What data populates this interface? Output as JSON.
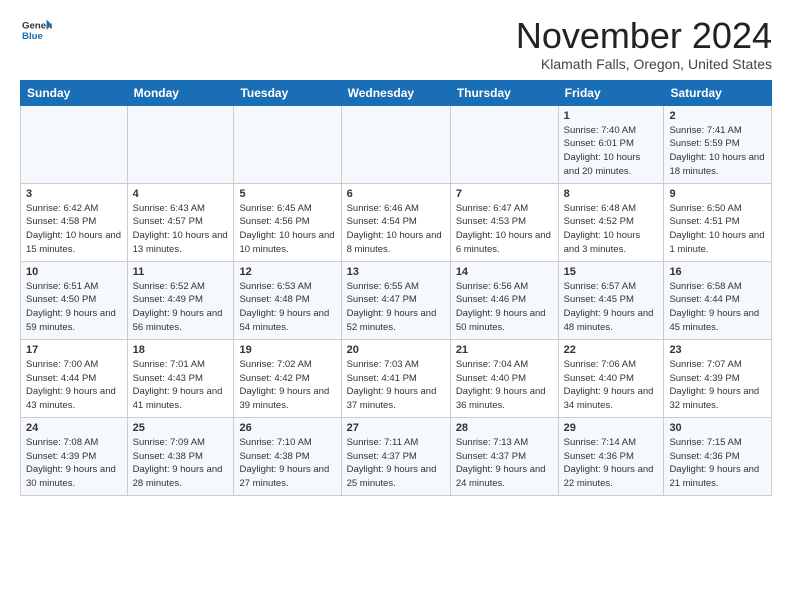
{
  "logo": {
    "line1": "General",
    "line2": "Blue"
  },
  "title": "November 2024",
  "location": "Klamath Falls, Oregon, United States",
  "weekdays": [
    "Sunday",
    "Monday",
    "Tuesday",
    "Wednesday",
    "Thursday",
    "Friday",
    "Saturday"
  ],
  "weeks": [
    [
      {
        "day": "",
        "info": ""
      },
      {
        "day": "",
        "info": ""
      },
      {
        "day": "",
        "info": ""
      },
      {
        "day": "",
        "info": ""
      },
      {
        "day": "",
        "info": ""
      },
      {
        "day": "1",
        "info": "Sunrise: 7:40 AM\nSunset: 6:01 PM\nDaylight: 10 hours and 20 minutes."
      },
      {
        "day": "2",
        "info": "Sunrise: 7:41 AM\nSunset: 5:59 PM\nDaylight: 10 hours and 18 minutes."
      }
    ],
    [
      {
        "day": "3",
        "info": "Sunrise: 6:42 AM\nSunset: 4:58 PM\nDaylight: 10 hours and 15 minutes."
      },
      {
        "day": "4",
        "info": "Sunrise: 6:43 AM\nSunset: 4:57 PM\nDaylight: 10 hours and 13 minutes."
      },
      {
        "day": "5",
        "info": "Sunrise: 6:45 AM\nSunset: 4:56 PM\nDaylight: 10 hours and 10 minutes."
      },
      {
        "day": "6",
        "info": "Sunrise: 6:46 AM\nSunset: 4:54 PM\nDaylight: 10 hours and 8 minutes."
      },
      {
        "day": "7",
        "info": "Sunrise: 6:47 AM\nSunset: 4:53 PM\nDaylight: 10 hours and 6 minutes."
      },
      {
        "day": "8",
        "info": "Sunrise: 6:48 AM\nSunset: 4:52 PM\nDaylight: 10 hours and 3 minutes."
      },
      {
        "day": "9",
        "info": "Sunrise: 6:50 AM\nSunset: 4:51 PM\nDaylight: 10 hours and 1 minute."
      }
    ],
    [
      {
        "day": "10",
        "info": "Sunrise: 6:51 AM\nSunset: 4:50 PM\nDaylight: 9 hours and 59 minutes."
      },
      {
        "day": "11",
        "info": "Sunrise: 6:52 AM\nSunset: 4:49 PM\nDaylight: 9 hours and 56 minutes."
      },
      {
        "day": "12",
        "info": "Sunrise: 6:53 AM\nSunset: 4:48 PM\nDaylight: 9 hours and 54 minutes."
      },
      {
        "day": "13",
        "info": "Sunrise: 6:55 AM\nSunset: 4:47 PM\nDaylight: 9 hours and 52 minutes."
      },
      {
        "day": "14",
        "info": "Sunrise: 6:56 AM\nSunset: 4:46 PM\nDaylight: 9 hours and 50 minutes."
      },
      {
        "day": "15",
        "info": "Sunrise: 6:57 AM\nSunset: 4:45 PM\nDaylight: 9 hours and 48 minutes."
      },
      {
        "day": "16",
        "info": "Sunrise: 6:58 AM\nSunset: 4:44 PM\nDaylight: 9 hours and 45 minutes."
      }
    ],
    [
      {
        "day": "17",
        "info": "Sunrise: 7:00 AM\nSunset: 4:44 PM\nDaylight: 9 hours and 43 minutes."
      },
      {
        "day": "18",
        "info": "Sunrise: 7:01 AM\nSunset: 4:43 PM\nDaylight: 9 hours and 41 minutes."
      },
      {
        "day": "19",
        "info": "Sunrise: 7:02 AM\nSunset: 4:42 PM\nDaylight: 9 hours and 39 minutes."
      },
      {
        "day": "20",
        "info": "Sunrise: 7:03 AM\nSunset: 4:41 PM\nDaylight: 9 hours and 37 minutes."
      },
      {
        "day": "21",
        "info": "Sunrise: 7:04 AM\nSunset: 4:40 PM\nDaylight: 9 hours and 36 minutes."
      },
      {
        "day": "22",
        "info": "Sunrise: 7:06 AM\nSunset: 4:40 PM\nDaylight: 9 hours and 34 minutes."
      },
      {
        "day": "23",
        "info": "Sunrise: 7:07 AM\nSunset: 4:39 PM\nDaylight: 9 hours and 32 minutes."
      }
    ],
    [
      {
        "day": "24",
        "info": "Sunrise: 7:08 AM\nSunset: 4:39 PM\nDaylight: 9 hours and 30 minutes."
      },
      {
        "day": "25",
        "info": "Sunrise: 7:09 AM\nSunset: 4:38 PM\nDaylight: 9 hours and 28 minutes."
      },
      {
        "day": "26",
        "info": "Sunrise: 7:10 AM\nSunset: 4:38 PM\nDaylight: 9 hours and 27 minutes."
      },
      {
        "day": "27",
        "info": "Sunrise: 7:11 AM\nSunset: 4:37 PM\nDaylight: 9 hours and 25 minutes."
      },
      {
        "day": "28",
        "info": "Sunrise: 7:13 AM\nSunset: 4:37 PM\nDaylight: 9 hours and 24 minutes."
      },
      {
        "day": "29",
        "info": "Sunrise: 7:14 AM\nSunset: 4:36 PM\nDaylight: 9 hours and 22 minutes."
      },
      {
        "day": "30",
        "info": "Sunrise: 7:15 AM\nSunset: 4:36 PM\nDaylight: 9 hours and 21 minutes."
      }
    ]
  ]
}
